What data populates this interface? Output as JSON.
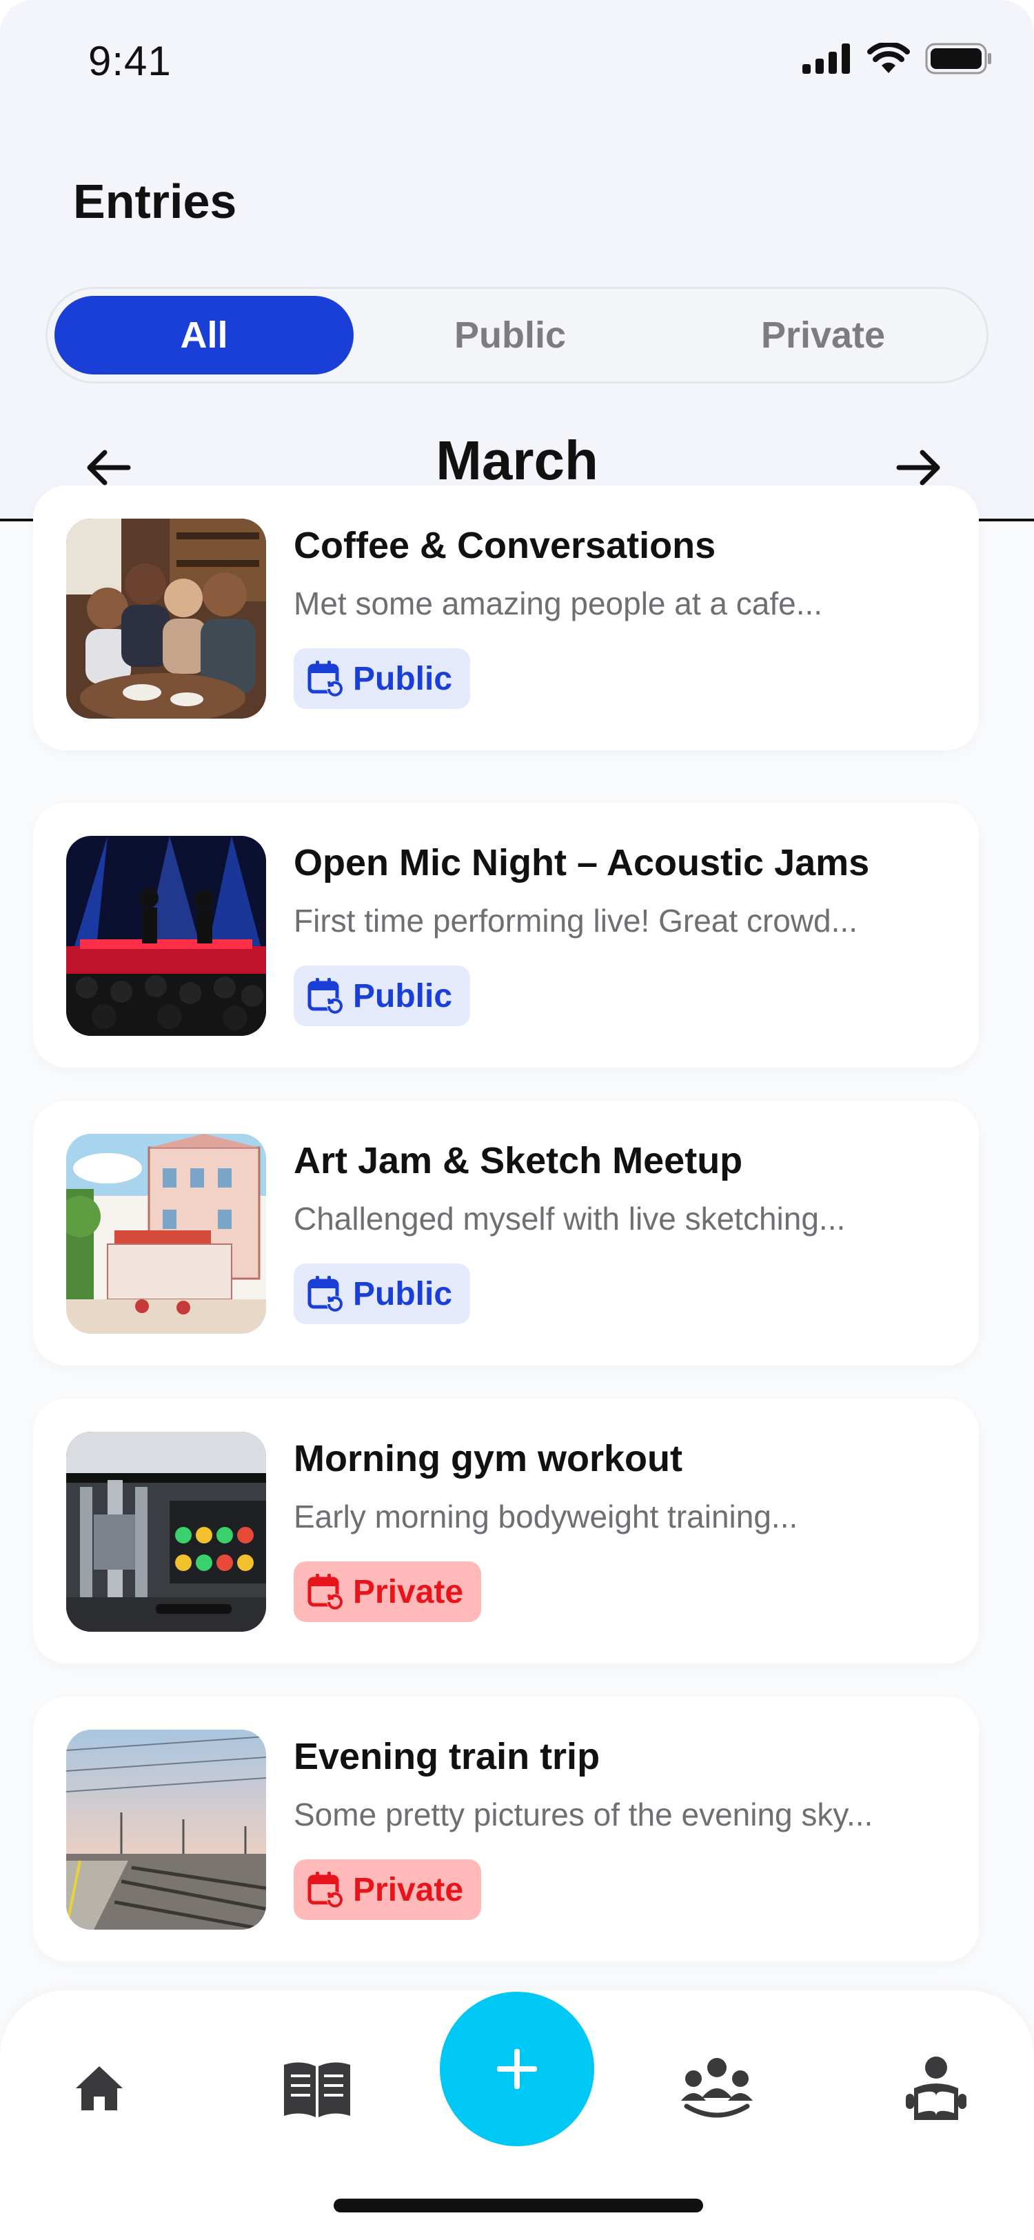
{
  "status_bar": {
    "time": "9:41"
  },
  "header": {
    "title": "Entries",
    "tabs": [
      {
        "label": "All",
        "active": true
      },
      {
        "label": "Public",
        "active": false
      },
      {
        "label": "Private",
        "active": false
      }
    ],
    "month": "March"
  },
  "entries": [
    {
      "title": "Coffee & Conversations",
      "description": "Met some amazing people at a cafe...",
      "visibility": "Public"
    },
    {
      "title": "Open Mic Night – Acoustic Jams",
      "description": "First time performing live! Great crowd...",
      "visibility": "Public"
    },
    {
      "title": "Art Jam & Sketch Meetup",
      "description": "Challenged myself with live sketching...",
      "visibility": "Public"
    },
    {
      "title": "Morning gym workout",
      "description": "Early morning bodyweight training...",
      "visibility": "Private"
    },
    {
      "title": "Evening train trip",
      "description": "Some pretty pictures of the evening sky...",
      "visibility": "Private"
    }
  ],
  "colors": {
    "accent": "#1a3fd6",
    "fab": "#00c8f4",
    "public_badge_bg": "#e4e9fb",
    "private_badge_bg": "#ffb9b9",
    "private_text": "#e8141c"
  },
  "bottom_nav": {
    "items": [
      {
        "icon": "home-icon"
      },
      {
        "icon": "journal-book-icon"
      },
      {
        "icon": "add-icon"
      },
      {
        "icon": "community-group-icon"
      },
      {
        "icon": "reader-profile-icon"
      }
    ]
  }
}
